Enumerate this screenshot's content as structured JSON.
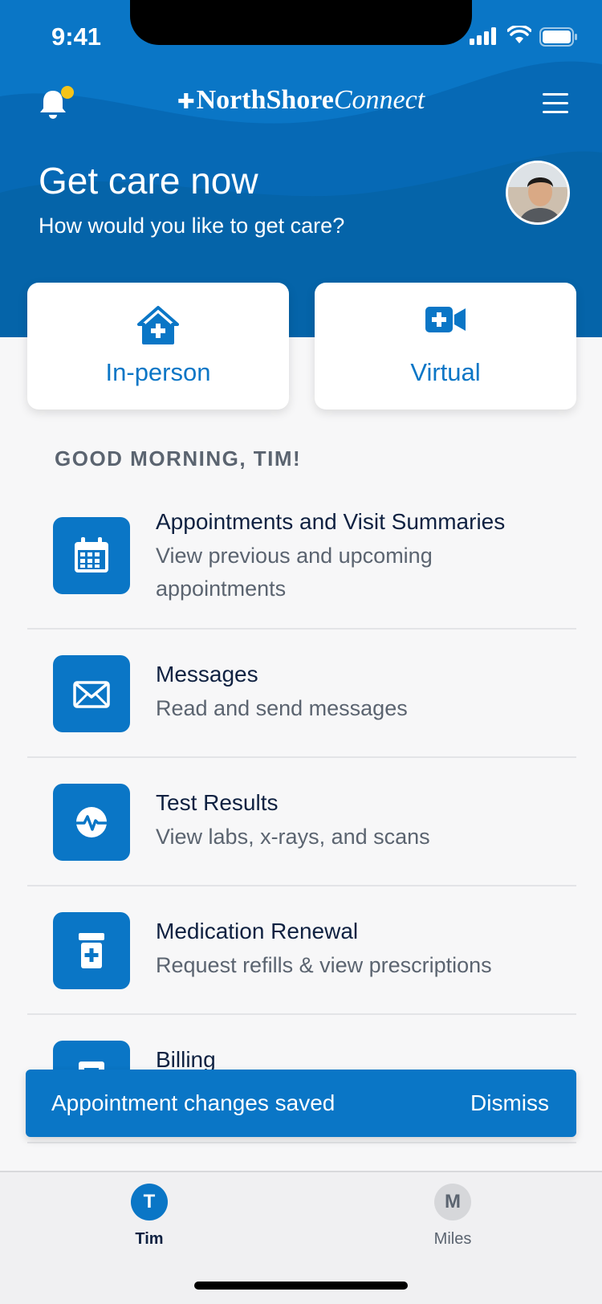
{
  "status_bar": {
    "time": "9:41"
  },
  "header": {
    "brand_bold": "NorthShore",
    "brand_italic": "Connect",
    "brand_mark": "✚"
  },
  "hero": {
    "title": "Get care now",
    "subtitle": "How would you like to get care?"
  },
  "care_options": [
    {
      "label": "In-person",
      "icon": "house-medical-icon"
    },
    {
      "label": "Virtual",
      "icon": "video-medical-icon"
    }
  ],
  "greeting": "GOOD MORNING, TIM!",
  "menu_items": [
    {
      "title": "Appointments and Visit Summaries",
      "description": "View previous and upcoming appointments",
      "icon": "calendar-icon"
    },
    {
      "title": "Messages",
      "description": "Read and send messages",
      "icon": "envelope-icon"
    },
    {
      "title": "Test Results",
      "description": "View labs, x-rays, and scans",
      "icon": "heart-pulse-icon"
    },
    {
      "title": "Medication Renewal",
      "description": "Request refills & view prescriptions",
      "icon": "prescription-bottle-icon"
    },
    {
      "title": "Billing",
      "description": "",
      "icon": "billing-icon"
    }
  ],
  "toast": {
    "message": "Appointment changes saved",
    "action": "Dismiss"
  },
  "tabs": [
    {
      "initial": "T",
      "name": "Tim",
      "active": true
    },
    {
      "initial": "M",
      "name": "Miles",
      "active": false
    }
  ],
  "colors": {
    "primary": "#0a76c6",
    "notification_dot": "#f5c419",
    "text_dark": "#0f2141",
    "text_muted": "#5b6470"
  }
}
